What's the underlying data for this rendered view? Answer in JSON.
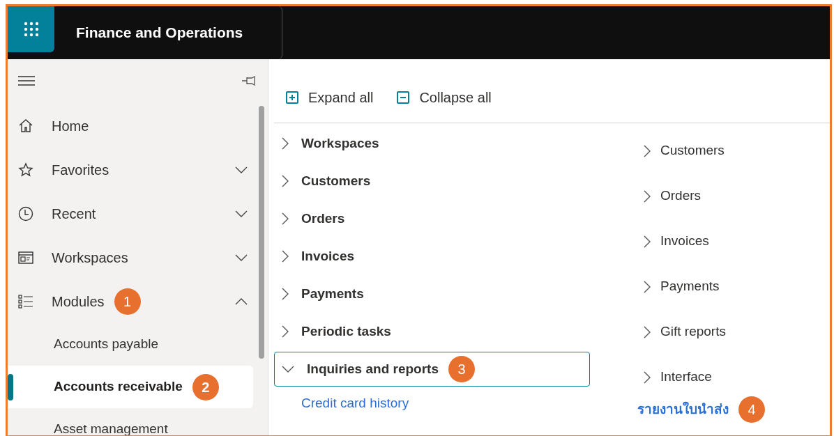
{
  "header": {
    "title": "Finance and Operations"
  },
  "sidebar": {
    "items": [
      {
        "kind": "home",
        "label": "Home"
      },
      {
        "kind": "favorites",
        "label": "Favorites",
        "expanded": false
      },
      {
        "kind": "recent",
        "label": "Recent",
        "expanded": false
      },
      {
        "kind": "workspaces",
        "label": "Workspaces",
        "expanded": false
      },
      {
        "kind": "modules",
        "label": "Modules",
        "expanded": true,
        "callout": "1",
        "children": [
          {
            "label": "Accounts payable",
            "selected": false
          },
          {
            "label": "Accounts receivable",
            "selected": true,
            "callout": "2"
          },
          {
            "label": "Asset management",
            "selected": false
          }
        ]
      }
    ]
  },
  "toolbar": [
    {
      "kind": "expand",
      "label": "Expand all"
    },
    {
      "kind": "collapse",
      "label": "Collapse all"
    }
  ],
  "left_column": [
    {
      "label": "Workspaces",
      "expanded": false,
      "focused": false
    },
    {
      "label": "Customers",
      "expanded": false,
      "focused": false
    },
    {
      "label": "Orders",
      "expanded": false,
      "focused": false
    },
    {
      "label": "Invoices",
      "expanded": false,
      "focused": false
    },
    {
      "label": "Payments",
      "expanded": false,
      "focused": false
    },
    {
      "label": "Periodic tasks",
      "expanded": false,
      "focused": false
    },
    {
      "label": "Inquiries and reports",
      "expanded": true,
      "focused": true,
      "callout": "3",
      "children": [
        {
          "label": "Credit card history"
        }
      ]
    }
  ],
  "right_column": [
    {
      "kind": "group",
      "label": "Customers"
    },
    {
      "kind": "group",
      "label": "Orders"
    },
    {
      "kind": "group",
      "label": "Invoices"
    },
    {
      "kind": "group",
      "label": "Payments"
    },
    {
      "kind": "group",
      "label": "Gift reports"
    },
    {
      "kind": "group",
      "label": "Interface"
    },
    {
      "kind": "link",
      "label": "รายงานใบนำส่ง",
      "callout": "4"
    }
  ]
}
